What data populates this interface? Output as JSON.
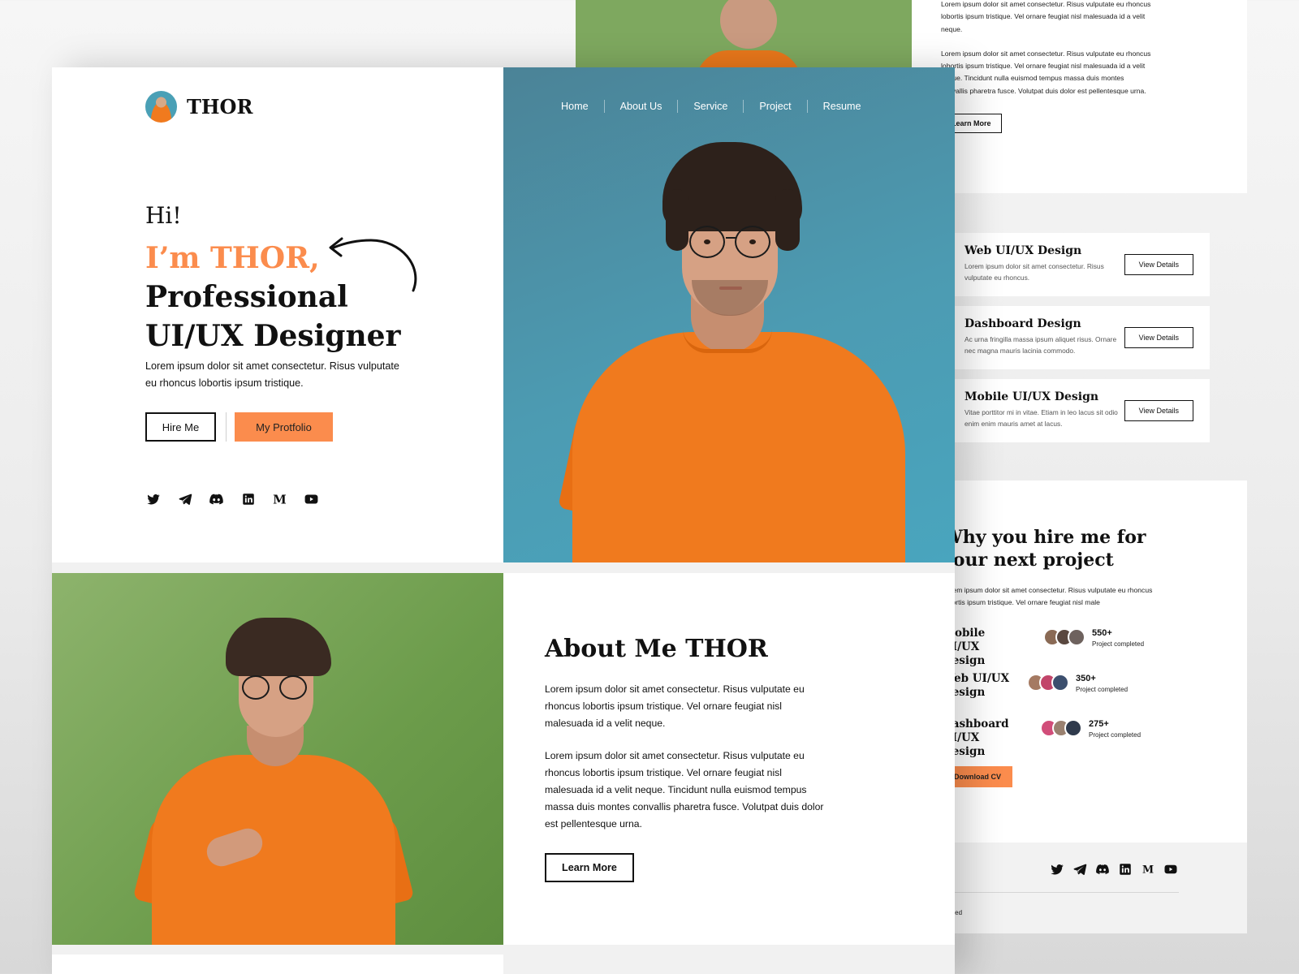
{
  "colors": {
    "accent": "#fb8c4d",
    "hero_bg": "#4c9bb2",
    "about_bg": "#7ea85f",
    "shirt": "#f07a1e"
  },
  "brand": {
    "name": "THOR"
  },
  "nav": {
    "items": [
      "Home",
      "About Us",
      "Service",
      "Project",
      "Resume"
    ]
  },
  "hero": {
    "greeting": "Hi!",
    "headline_accent": "I’m THOR,",
    "headline_line2": "Professional",
    "headline_line3": "UI/UX Designer",
    "intro": "Lorem ipsum dolor sit amet consectetur. Risus vulputate eu rhoncus lobortis ipsum tristique.",
    "hire_button": "Hire Me",
    "portfolio_button": "My Protfolio",
    "social_icons": [
      "twitter-icon",
      "telegram-icon",
      "discord-icon",
      "linkedin-icon",
      "medium-icon",
      "youtube-icon"
    ]
  },
  "about": {
    "title": "About Me THOR",
    "paragraph1": "Lorem ipsum dolor sit amet consectetur. Risus vulputate eu rhoncus lobortis ipsum tristique. Vel ornare feugiat nisl malesuada id a velit neque.",
    "paragraph2": "Lorem ipsum dolor sit amet consectetur. Risus vulputate eu rhoncus lobortis ipsum tristique. Vel ornare feugiat nisl malesuada id a velit neque. Tincidunt nulla euismod tempus massa duis montes convallis pharetra fusce. Volutpat duis dolor est pellentesque urna.",
    "button": "Learn More"
  },
  "back_page": {
    "about": {
      "paragraph1": "Lorem ipsum dolor sit amet consectetur. Risus vulputate eu rhoncus lobortis ipsum tristique. Vel ornare feugiat nisl malesuada id a velit neque.",
      "paragraph2": "Lorem ipsum dolor sit amet consectetur. Risus vulputate eu rhoncus lobortis ipsum tristique. Vel ornare feugiat nisl malesuada id a velit neque. Tincidunt nulla euismod tempus massa duis montes convallis pharetra fusce. Volutpat duis dolor est pellentesque urna.",
      "button": "Learn More"
    },
    "services": [
      {
        "title": "Web UI/UX Design",
        "description": "Lorem ipsum dolor sit amet consectetur. Risus vulputate eu rhoncus.",
        "button": "View Details"
      },
      {
        "title": "Dashboard Design",
        "description": "Ac urna fringilla massa ipsum aliquet risus. Ornare nec magna mauris lacinia commodo.",
        "button": "View Details"
      },
      {
        "title": "Mobile UI/UX Design",
        "description": "Vitae porttitor mi in vitae. Etiam in leo lacus sit odio enim enim mauris amet at lacus.",
        "button": "View Details"
      }
    ],
    "why": {
      "title": "Why you hire me for your next project",
      "description": "Lorem ipsum dolor sit amet consectetur. Risus vulputate eu rhoncus lobortis ipsum tristique. Vel ornare feugiat nisl male",
      "stats": [
        {
          "name": "Mobile UI/UX Design",
          "count": "550+",
          "label": "Project completed"
        },
        {
          "name": "Web UI/UX Design",
          "count": "350+",
          "label": "Project completed"
        },
        {
          "name": "Dashboard UI/UX Design",
          "count": "275+",
          "label": "Project completed"
        }
      ],
      "button": "Download CV"
    },
    "footer": {
      "copyright": "served"
    }
  }
}
